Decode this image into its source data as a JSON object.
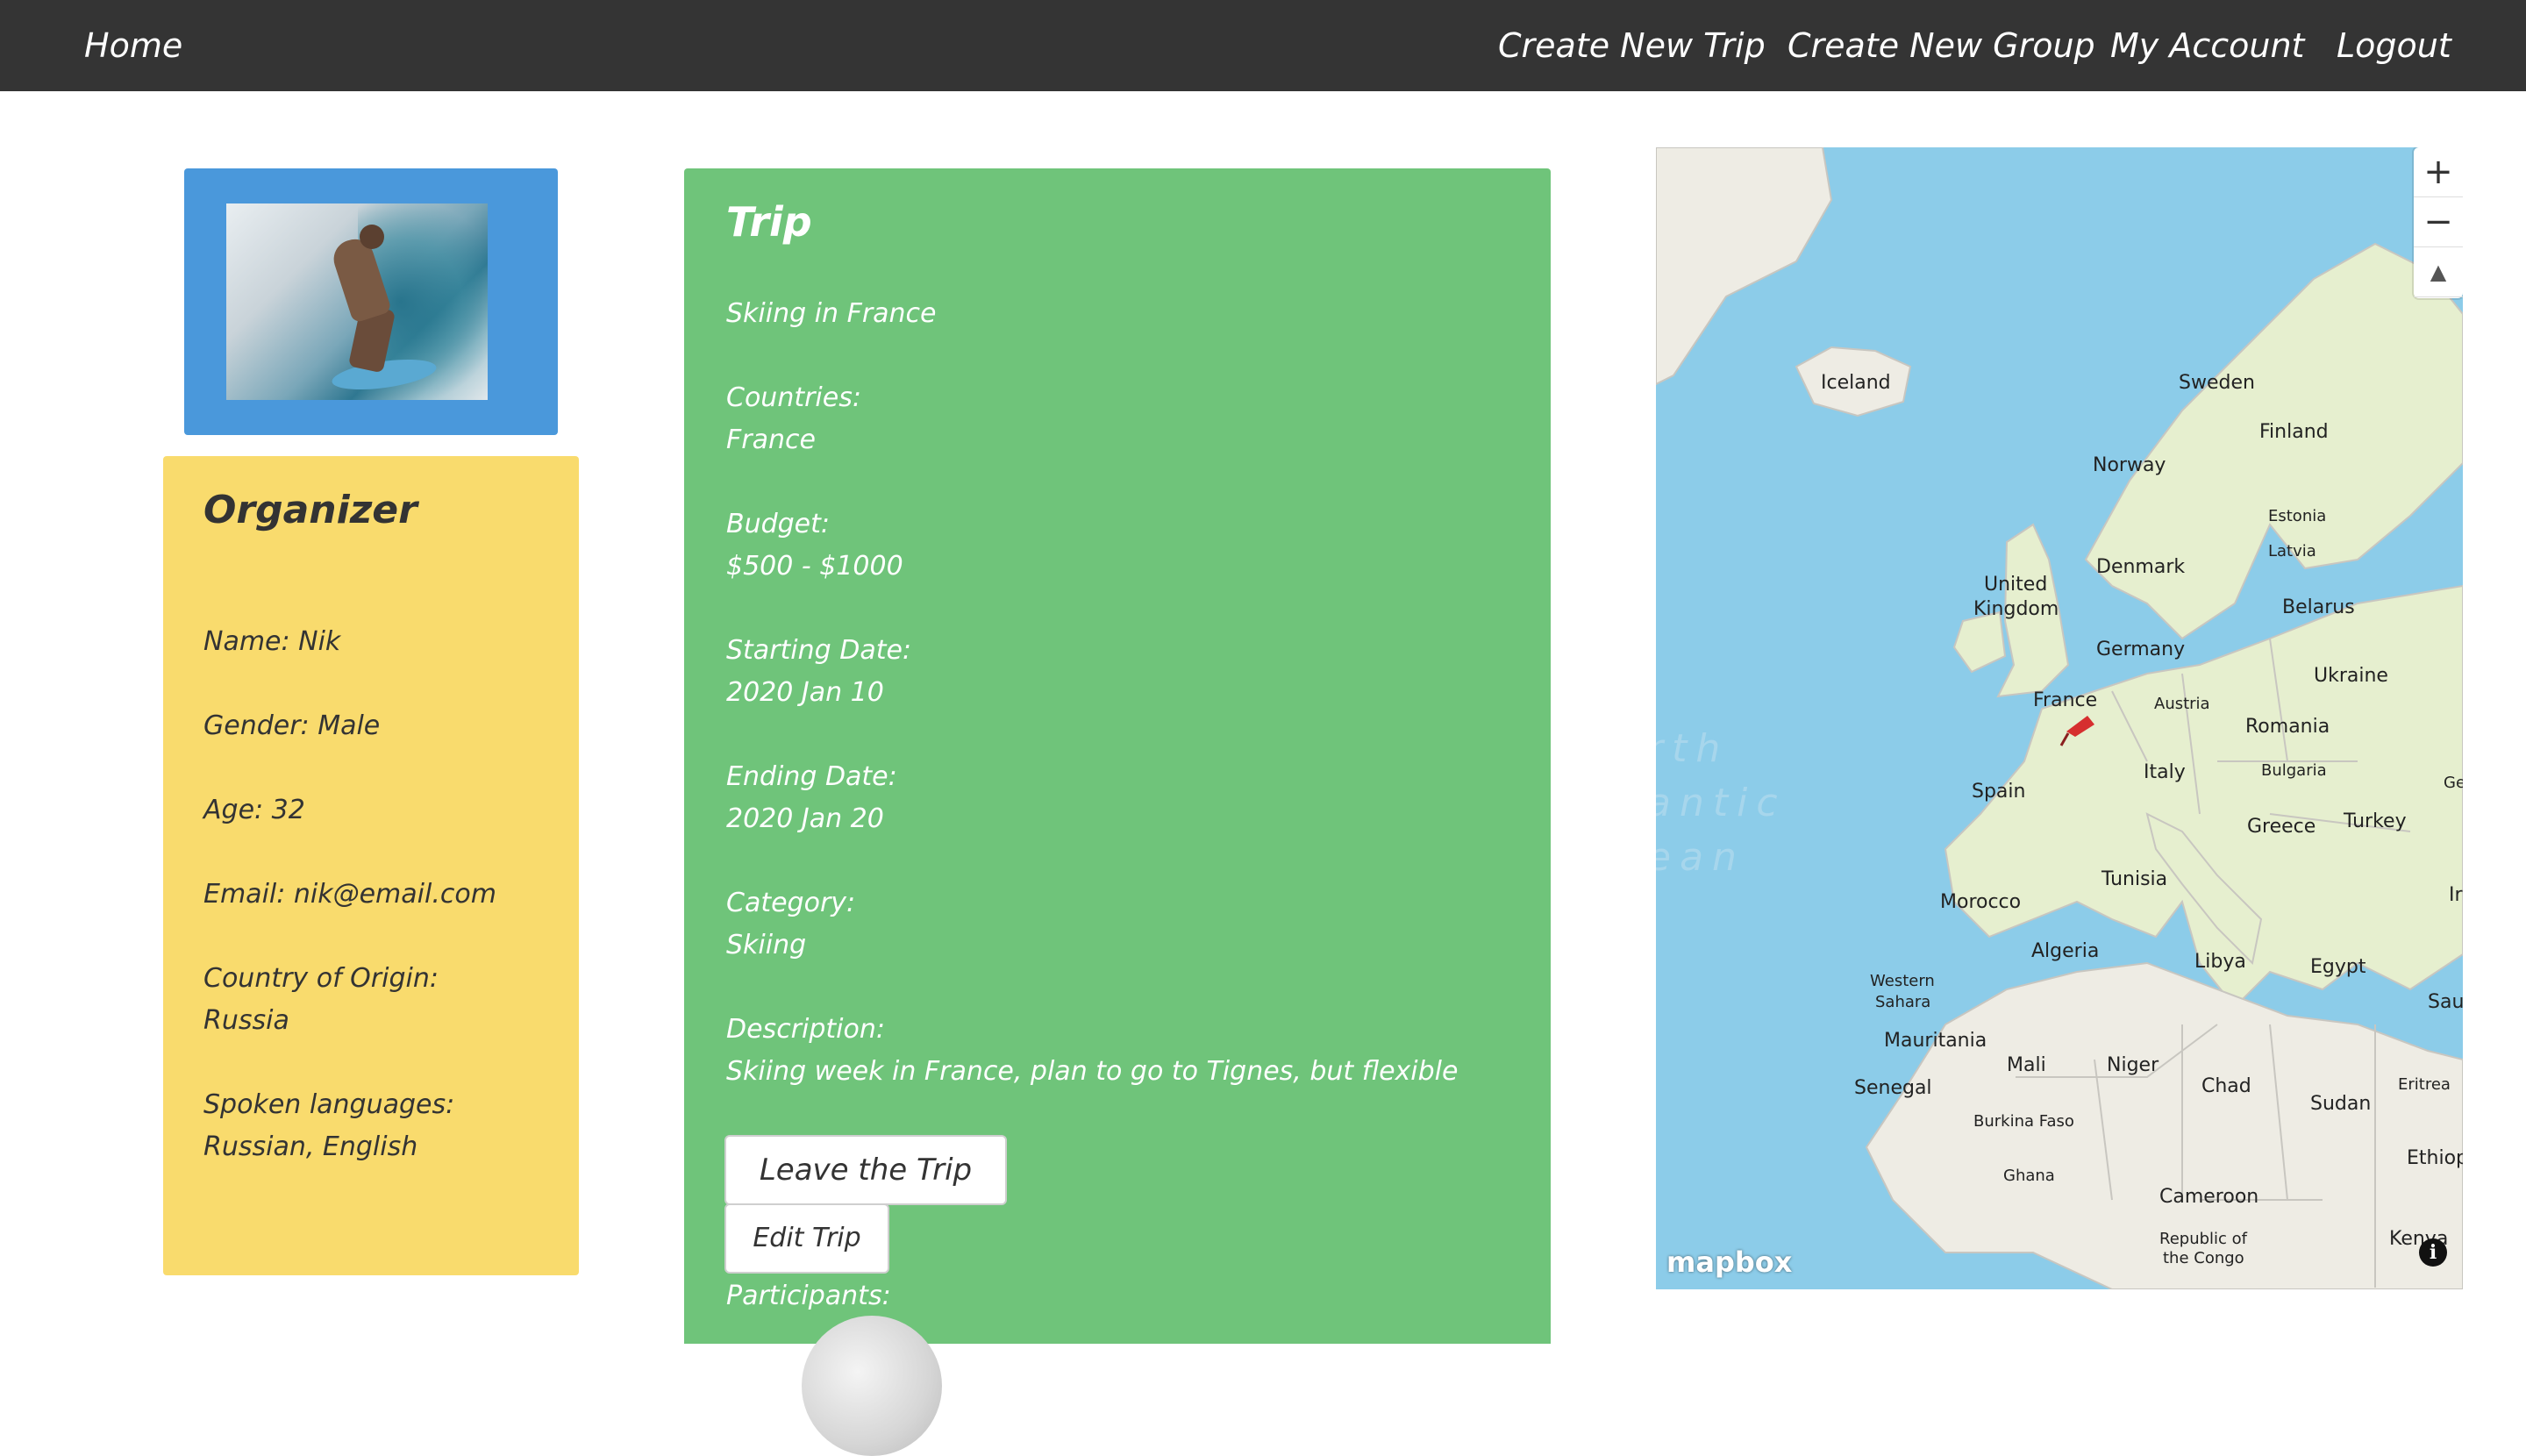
{
  "nav": {
    "home": "Home",
    "create_trip": "Create New Trip",
    "create_group": "Create New Group",
    "my_account": "My Account",
    "logout": "Logout"
  },
  "organizer": {
    "title": "Organizer",
    "name": "Name: Nik",
    "gender": "Gender: Male",
    "age": "Age: 32",
    "email": "Email: nik@email.com",
    "country_label": "Country of Origin:",
    "country": "Russia",
    "languages_label": "Spoken languages:",
    "languages": "Russian, English"
  },
  "trip": {
    "title": "Trip",
    "name": "Skiing in France",
    "countries_label": "Countries:",
    "countries": "France",
    "budget_label": "Budget:",
    "budget": "$500 - $1000",
    "start_label": "Starting Date:",
    "start": "2020 Jan 10",
    "end_label": "Ending Date:",
    "end": "2020 Jan 20",
    "category_label": "Category:",
    "category": "Skiing",
    "description_label": "Description:",
    "description": "Skiing week in France, plan to go to Tignes, but flexible",
    "leave_button": "Leave the Trip",
    "edit_button": "Edit Trip",
    "participants_label": "Participants:"
  },
  "map": {
    "zoom_in": "+",
    "zoom_out": "−",
    "compass": "▲",
    "logo": "mapbox",
    "info": "i",
    "ocean": [
      "rth",
      "antic",
      "ean"
    ],
    "labels": {
      "iceland": "Iceland",
      "sweden": "Sweden",
      "finland": "Finland",
      "norway": "Norway",
      "estonia": "Estonia",
      "latvia": "Latvia",
      "uk_1": "United",
      "uk_2": "Kingdom",
      "denmark": "Denmark",
      "belarus": "Belarus",
      "germany": "Germany",
      "ukraine": "Ukraine",
      "france": "France",
      "austria": "Austria",
      "romania": "Romania",
      "italy": "Italy",
      "bulgaria": "Bulgaria",
      "spain": "Spain",
      "greece": "Greece",
      "turkey": "Turkey",
      "ge": "Ge",
      "tunisia": "Tunisia",
      "morocco": "Morocco",
      "algeria": "Algeria",
      "libya": "Libya",
      "egypt": "Egypt",
      "western_sahara_1": "Western",
      "western_sahara_2": "Sahara",
      "mauritania": "Mauritania",
      "mali": "Mali",
      "niger": "Niger",
      "chad": "Chad",
      "sudan": "Sudan",
      "eritrea": "Eritrea",
      "senegal": "Senegal",
      "burkina_faso": "Burkina Faso",
      "ghana": "Ghana",
      "cameroon": "Cameroon",
      "ethiopia": "Ethiopi",
      "congo_1": "Republic of",
      "congo_2": "the Congo",
      "kenya": "Kenya",
      "sau": "Sau",
      "ir": "Ir"
    }
  },
  "colors": {
    "navbar": "#343434",
    "photo_card": "#4a98db",
    "organizer_card": "#f9db6d",
    "trip_card": "#6fc47a",
    "pin": "#d62f2f"
  }
}
